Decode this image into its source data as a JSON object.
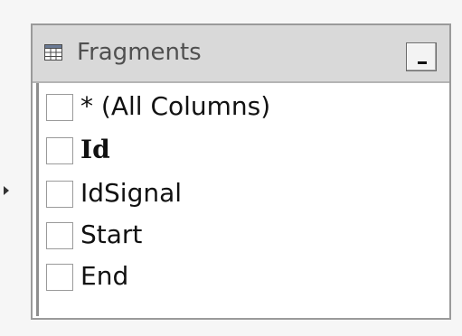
{
  "table": {
    "title": "Fragments",
    "minimize_label": "_",
    "columns": [
      {
        "label": "* (All Columns)",
        "checked": false,
        "is_key": false
      },
      {
        "label": "Id",
        "checked": false,
        "is_key": true
      },
      {
        "label": "IdSignal",
        "checked": false,
        "is_key": false
      },
      {
        "label": "Start",
        "checked": false,
        "is_key": false
      },
      {
        "label": "End",
        "checked": false,
        "is_key": false
      }
    ]
  },
  "icons": {
    "table": "table-grid-icon",
    "minimize": "minimize-icon",
    "connector": "relationship-connector-icon"
  },
  "colors": {
    "title_bar": "#d9d9d9",
    "border": "#9a9a9a",
    "background": "#ffffff"
  }
}
